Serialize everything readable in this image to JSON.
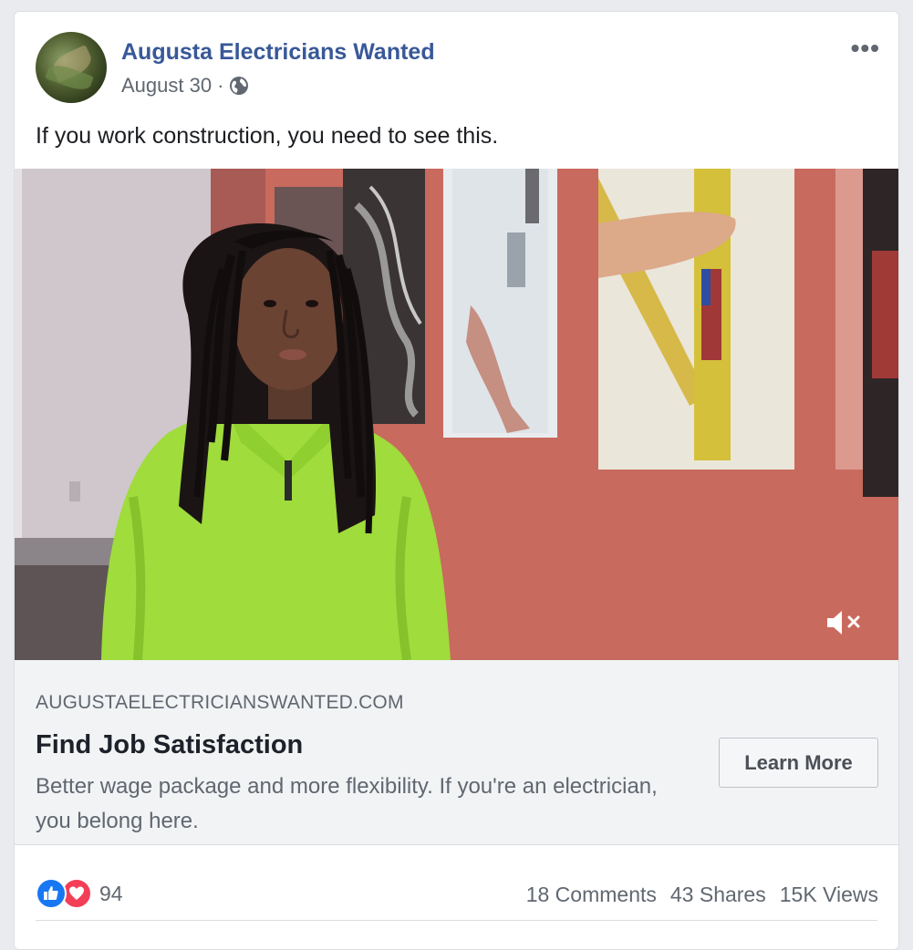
{
  "post": {
    "page_name": "Augusta Electricians Wanted",
    "date": "August 30",
    "separator": "·",
    "audience_icon": "globe-icon",
    "more_icon": "ellipsis-icon",
    "more_label": "•••",
    "message": "If you work construction, you need to see this."
  },
  "video": {
    "mute_icon": "speaker-muted-icon"
  },
  "link": {
    "domain": "AUGUSTAELECTRICIANSWANTED.COM",
    "headline": "Find Job Satisfaction",
    "description": "Better wage package and more flexibility. If you're an electrician, you belong here.",
    "cta_label": "Learn More"
  },
  "stats": {
    "reaction_icons": [
      "like-icon",
      "love-icon"
    ],
    "reaction_count": "94",
    "comments": "18 Comments",
    "shares": "43 Shares",
    "views": "15K Views"
  },
  "colors": {
    "page_name": "#385898",
    "like": "#1877f2",
    "love": "#f33e58",
    "wall": "#c96a5e",
    "shirt": "#9fdc3c"
  }
}
